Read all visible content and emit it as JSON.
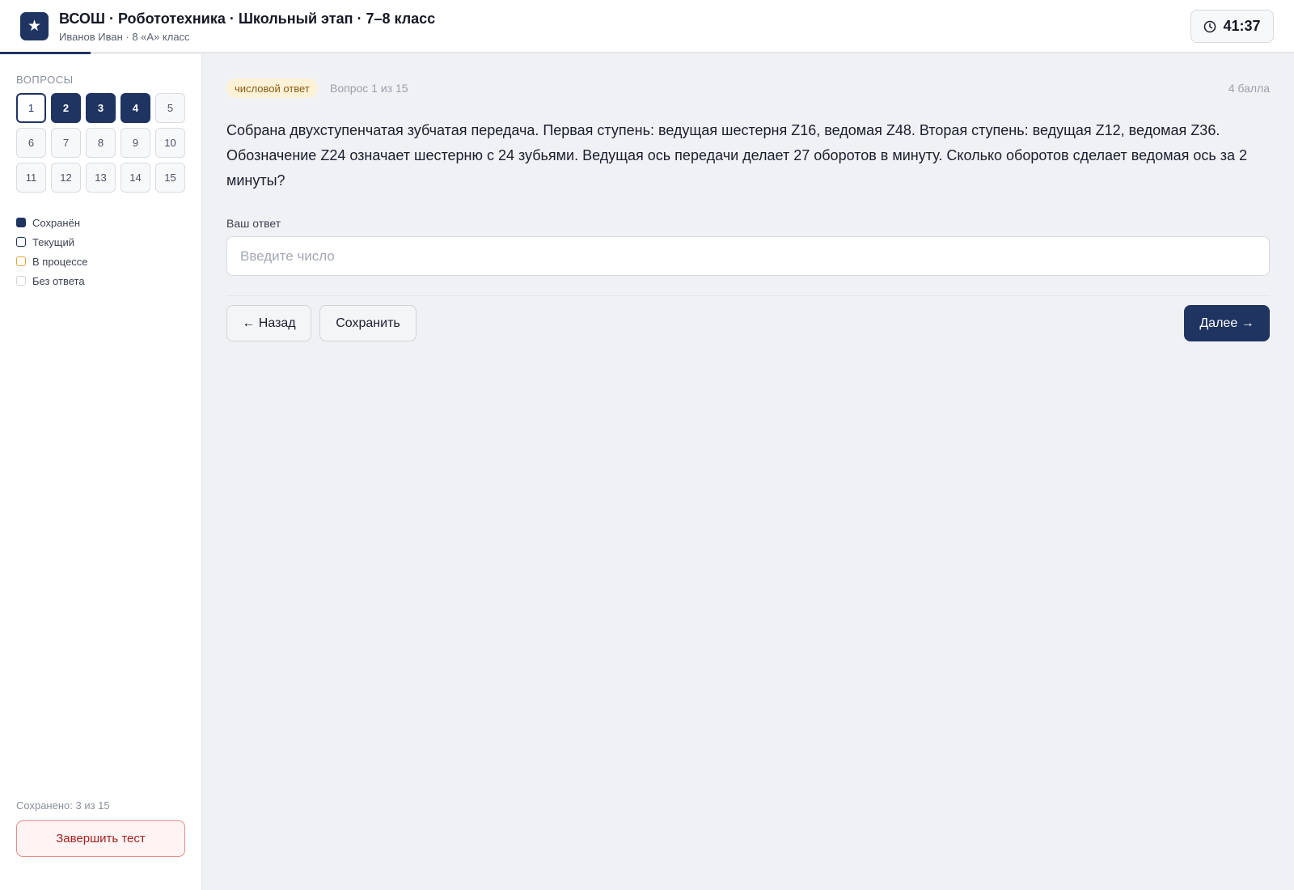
{
  "header": {
    "logo_glyph": "★",
    "title": "ВСОШ · Робототехника · Школьный этап · 7–8 класс",
    "subtitle": "Иванов Иван · 8 «А» класс",
    "timer": "41:37",
    "progress_fraction": 0.07
  },
  "sidebar": {
    "heading": "ВОПРОСЫ",
    "questions": [
      {
        "label": "1",
        "status": "current"
      },
      {
        "label": "2",
        "status": "saved"
      },
      {
        "label": "3",
        "status": "saved"
      },
      {
        "label": "4",
        "status": "saved"
      },
      {
        "label": "5",
        "status": "empty"
      },
      {
        "label": "6",
        "status": "empty"
      },
      {
        "label": "7",
        "status": "empty"
      },
      {
        "label": "8",
        "status": "empty"
      },
      {
        "label": "9",
        "status": "empty"
      },
      {
        "label": "10",
        "status": "empty"
      },
      {
        "label": "11",
        "status": "empty"
      },
      {
        "label": "12",
        "status": "empty"
      },
      {
        "label": "13",
        "status": "empty"
      },
      {
        "label": "14",
        "status": "empty"
      },
      {
        "label": "15",
        "status": "empty"
      }
    ],
    "legend": [
      {
        "key": "saved",
        "label": "Сохранён"
      },
      {
        "key": "current",
        "label": "Текущий"
      },
      {
        "key": "progress",
        "label": "В процессе"
      },
      {
        "key": "empty",
        "label": "Без ответа"
      }
    ],
    "saved_count": "Сохранено: 3 из 15",
    "finish_label": "Завершить тест"
  },
  "main": {
    "badge": "числовой ответ",
    "counter": "Вопрос 1 из 15",
    "points": "4 балла",
    "question_text": "Собрана двухступенчатая зубчатая передача. Первая ступень: ведущая шестерня Z16, ведомая Z48. Вторая ступень: ведущая Z12, ведомая Z36. Обозначение Z24 означает шестерню с 24 зубьями. Ведущая ось передачи делает 27 оборотов в минуту. Сколько оборотов сделает ведомая ось за 2 минуты?",
    "answer_label": "Ваш ответ",
    "answer_value": "",
    "answer_placeholder": "Введите число",
    "back_label": "← Назад",
    "save_label": "Сохранить",
    "next_label": "Далее →"
  },
  "colors": {
    "accent": "#1f3461",
    "in_progress": "#e0a53a",
    "danger": "#a32222",
    "badge_bg": "#fdf2d8"
  }
}
